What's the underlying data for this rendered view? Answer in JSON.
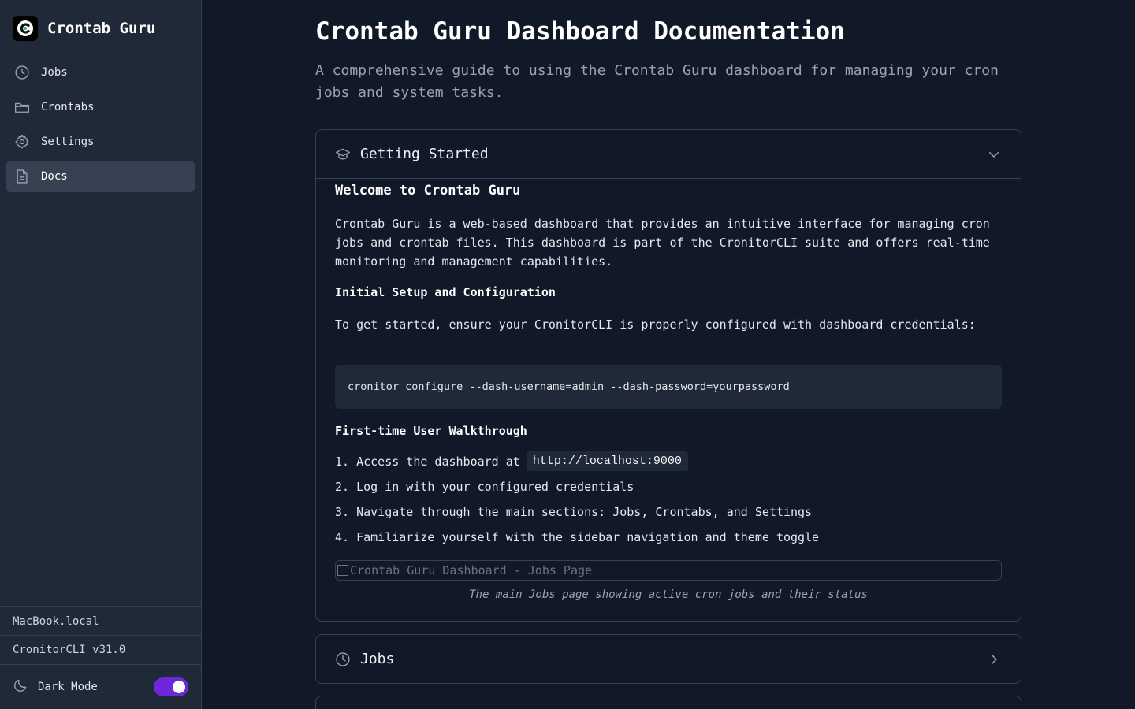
{
  "app": {
    "name": "Crontab Guru",
    "logo_letter": "C",
    "accent": "#6d28d9",
    "logo_accent": "#22c55e"
  },
  "sidebar": {
    "items": [
      {
        "label": "Jobs",
        "icon": "clock-icon",
        "active": false
      },
      {
        "label": "Crontabs",
        "icon": "folder-icon",
        "active": false
      },
      {
        "label": "Settings",
        "icon": "gear-icon",
        "active": false
      },
      {
        "label": "Docs",
        "icon": "document-icon",
        "active": true
      }
    ],
    "hostname": "MacBook.local",
    "version": "CronitorCLI v31.0",
    "dark_mode_label": "Dark Mode",
    "dark_mode_on": true
  },
  "page": {
    "title": "Crontab Guru Dashboard Documentation",
    "subtitle": "A comprehensive guide to using the Crontab Guru dashboard for managing your cron jobs and system tasks."
  },
  "sections": {
    "getting_started": {
      "title": "Getting Started",
      "icon": "graduation-cap-icon",
      "expanded": true,
      "heading": "Welcome to Crontab Guru",
      "intro": "Crontab Guru is a web-based dashboard that provides an intuitive interface for managing cron jobs and crontab files. This dashboard is part of the CronitorCLI suite and offers real-time monitoring and management capabilities.",
      "setup_heading": "Initial Setup and Configuration",
      "setup_text": "To get started, ensure your CronitorCLI is properly configured with dashboard credentials:",
      "code": "cronitor configure --dash-username=admin --dash-password=yourpassword",
      "walkthrough_heading": "First-time User Walkthrough",
      "steps": [
        "1. Access the dashboard at",
        "2. Log in with your configured credentials",
        "3. Navigate through the main sections: Jobs, Crontabs, and Settings",
        "4. Familiarize yourself with the sidebar navigation and theme toggle"
      ],
      "step1_code": "http://localhost:9000",
      "image_alt": "Crontab Guru Dashboard - Jobs Page",
      "caption": "The main Jobs page showing active cron jobs and their status"
    },
    "jobs": {
      "title": "Jobs",
      "icon": "clock-icon",
      "expanded": false
    }
  }
}
